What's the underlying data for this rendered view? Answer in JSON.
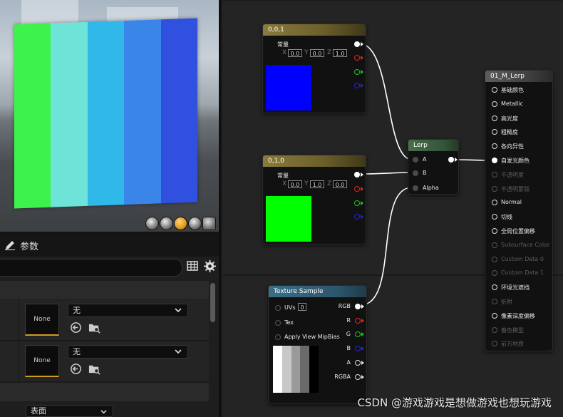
{
  "viewport": {
    "preview_colors": [
      "#3df24a",
      "#6ee4d8",
      "#2fb8e8",
      "#3a86e8",
      "#3050e0"
    ]
  },
  "details": {
    "tab_label": "参数",
    "search": {
      "placeholder": ""
    },
    "params": [
      {
        "texture": "None",
        "dropdown": "无"
      },
      {
        "texture": "None",
        "dropdown": "无"
      }
    ],
    "surface_dropdown": "表面"
  },
  "graph": {
    "const_blue": {
      "title": "0,0,1",
      "label": "常量",
      "x": "0.0",
      "y": "0.0",
      "z": "1.0",
      "swatch": "#0000ff"
    },
    "const_green": {
      "title": "0,1,0",
      "label": "常量",
      "x": "0.0",
      "y": "1.0",
      "z": "0.0",
      "swatch": "#00ff00"
    },
    "axis": {
      "x": "X",
      "y": "Y",
      "z": "Z"
    },
    "lerp": {
      "title": "Lerp",
      "pins": [
        "A",
        "B",
        "Alpha"
      ]
    },
    "texture_sample": {
      "title": "Texture Sample",
      "inputs": [
        {
          "label": "UVs",
          "value": "0"
        },
        {
          "label": "Tex"
        },
        {
          "label": "Apply View MipBias"
        }
      ],
      "outputs": [
        "RGB",
        "R",
        "G",
        "B",
        "A",
        "RGBA"
      ]
    },
    "material": {
      "title": "01_M_Lerp",
      "pins": [
        {
          "label": "基础颜色",
          "enabled": true
        },
        {
          "label": "Metallic",
          "enabled": true
        },
        {
          "label": "高光度",
          "enabled": true
        },
        {
          "label": "粗糙度",
          "enabled": true
        },
        {
          "label": "各向异性",
          "enabled": true
        },
        {
          "label": "自发光颜色",
          "enabled": true,
          "connected": true
        },
        {
          "label": "不透明度",
          "enabled": false
        },
        {
          "label": "不透明蒙版",
          "enabled": false
        },
        {
          "label": "Normal",
          "enabled": true
        },
        {
          "label": "切线",
          "enabled": true
        },
        {
          "label": "全局位置偏移",
          "enabled": true
        },
        {
          "label": "Subsurface Color",
          "enabled": false
        },
        {
          "label": "Custom Data 0",
          "enabled": false
        },
        {
          "label": "Custom Data 1",
          "enabled": false
        },
        {
          "label": "环境光遮挡",
          "enabled": true
        },
        {
          "label": "折射",
          "enabled": false
        },
        {
          "label": "像素深度偏移",
          "enabled": true
        },
        {
          "label": "着色模型",
          "enabled": false
        },
        {
          "label": "前方材质",
          "enabled": false
        }
      ]
    }
  },
  "watermark": "CSDN @游戏游戏是想做游戏也想玩游戏"
}
